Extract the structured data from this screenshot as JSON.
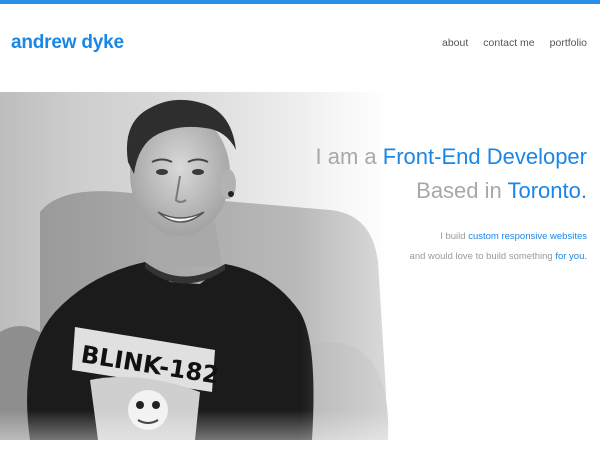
{
  "header": {
    "logo_text": "andrew dyke",
    "nav": [
      {
        "label": "about"
      },
      {
        "label": "contact me"
      },
      {
        "label": "portfolio"
      }
    ]
  },
  "hero": {
    "photo_description_icon": "person-photo",
    "shirt_text": "BLINK-182",
    "line1_prefix": "I am a",
    "line1_highlight": "Front-End Developer",
    "line2_prefix": "Based in",
    "line2_highlight": "Toronto",
    "line2_suffix": ".",
    "sub1_prefix": "I build",
    "sub1_highlight": "custom responsive websites",
    "sub2_prefix": "and would love to build something",
    "sub2_highlight": "for you."
  },
  "colors": {
    "accent": "#1a86e6",
    "top_bar": "#2a8fe8",
    "muted_text": "#a8a8a8"
  }
}
